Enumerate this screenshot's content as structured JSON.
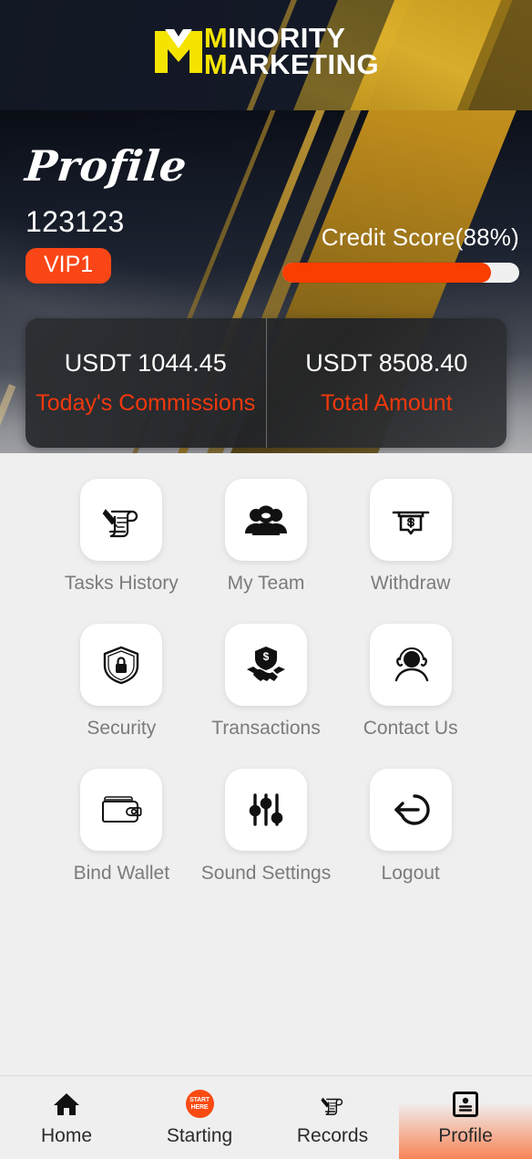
{
  "header": {
    "logo_mark": "mm-monogram-icon",
    "brand_line1_initial": "M",
    "brand_line1_rest": "INORITY",
    "brand_line2_initial": "M",
    "brand_line2_rest": "ARKETING",
    "bg_color": "#141927",
    "accent_yellow": "#f5e400"
  },
  "hero": {
    "title": "Profile",
    "username": "123123",
    "vip_badge": "VIP1",
    "credit_label": "Credit Score(88%)",
    "credit_percent": 88,
    "accent_orange": "#fa4616",
    "stats": [
      {
        "value": "USDT 1044.45",
        "label": "Today's Commissions"
      },
      {
        "value": "USDT 8508.40",
        "label": "Total Amount"
      }
    ]
  },
  "menu": {
    "items": [
      {
        "label": "Tasks History",
        "icon": "scroll-quill-icon"
      },
      {
        "label": "My Team",
        "icon": "people-group-icon"
      },
      {
        "label": "Withdraw",
        "icon": "atm-cash-dollar-icon"
      },
      {
        "label": "Security",
        "icon": "shield-lock-icon"
      },
      {
        "label": "Transactions",
        "icon": "handshake-shield-dollar-icon"
      },
      {
        "label": "Contact Us",
        "icon": "headset-support-icon"
      },
      {
        "label": "Bind Wallet",
        "icon": "wallet-icon"
      },
      {
        "label": "Sound Settings",
        "icon": "sliders-icon"
      },
      {
        "label": "Logout",
        "icon": "logout-arrow-icon"
      }
    ]
  },
  "tabbar": {
    "active_index": 3,
    "active_gradient": "#f97c4a",
    "items": [
      {
        "label": "Home",
        "icon": "home-icon"
      },
      {
        "label": "Starting",
        "icon": "start-here-badge-icon",
        "badge_line1": "START",
        "badge_line2": "HERE"
      },
      {
        "label": "Records",
        "icon": "scroll-quill-icon"
      },
      {
        "label": "Profile",
        "icon": "id-card-icon"
      }
    ]
  }
}
